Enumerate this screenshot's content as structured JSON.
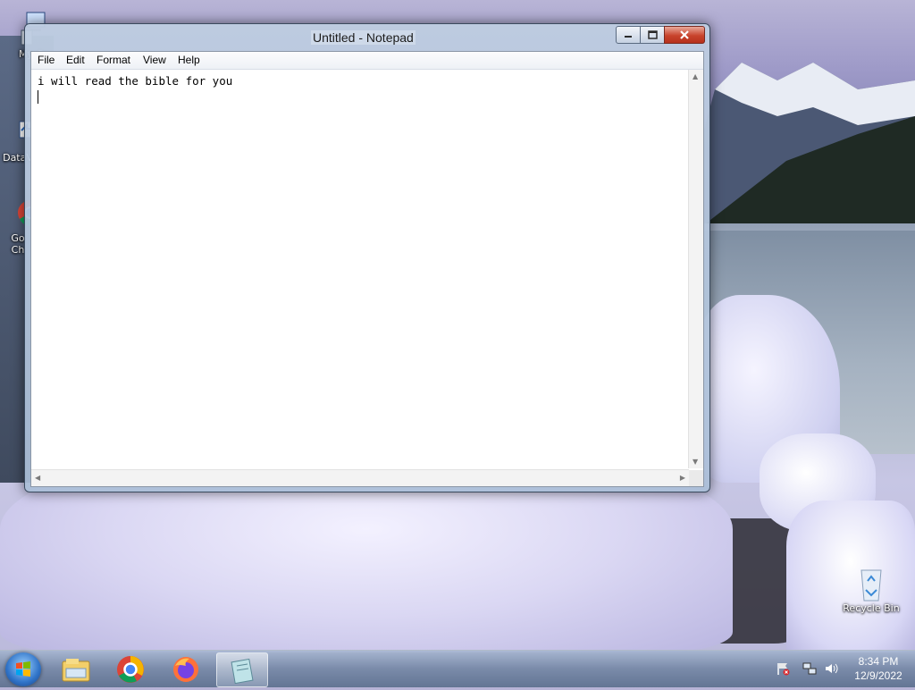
{
  "desktop": {
    "icons": [
      {
        "label": "My Co",
        "name": "my-computer"
      },
      {
        "label": "DataV",
        "name": "datav"
      },
      {
        "label": "Go\nCh",
        "name": "google-chrome"
      },
      {
        "label": "Recycle Bin",
        "name": "recycle-bin"
      }
    ]
  },
  "window": {
    "title": "Untitled - Notepad",
    "menu": [
      "File",
      "Edit",
      "Format",
      "View",
      "Help"
    ],
    "content": "i will read the bible for you"
  },
  "taskbar": {
    "apps": [
      "windows-explorer-icon",
      "chrome-icon",
      "firefox-icon",
      "notepad-icon"
    ],
    "active_app": "notepad-icon",
    "clock_time": "8:34 PM",
    "clock_date": "12/9/2022"
  },
  "colors": {
    "close_button": "#c8432c",
    "taskbar": "#6e82a0"
  }
}
